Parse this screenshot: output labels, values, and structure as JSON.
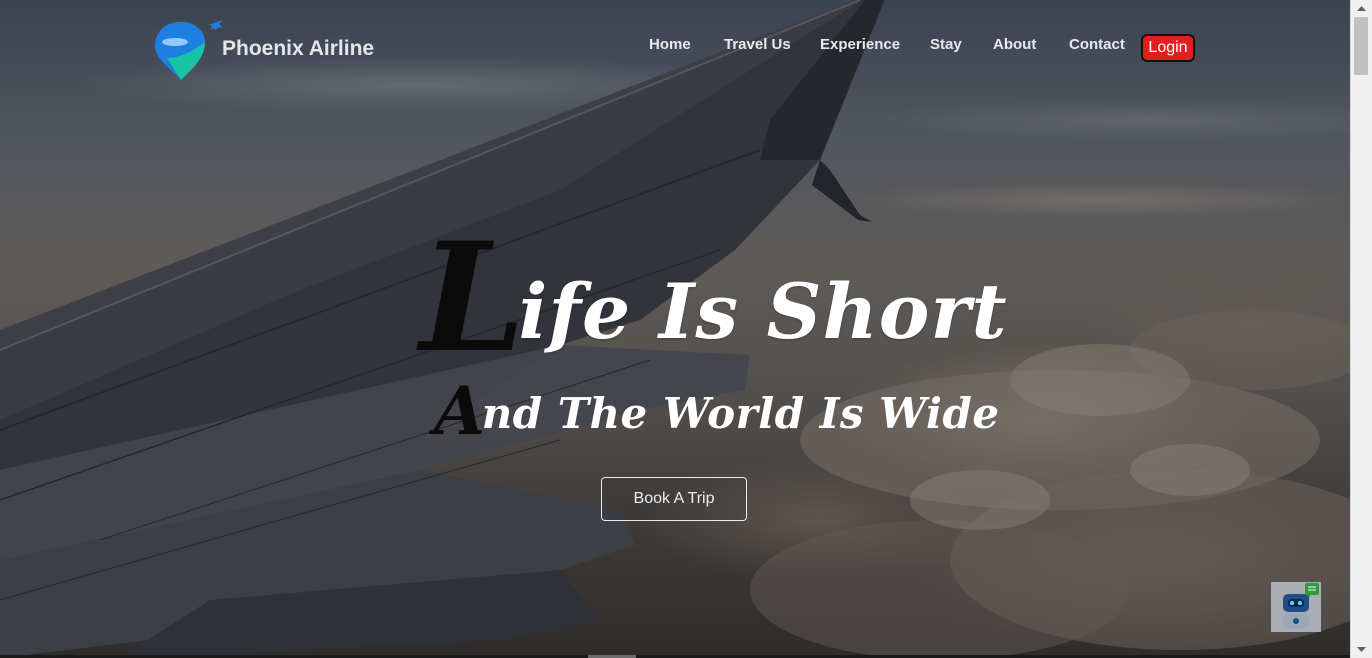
{
  "brand": {
    "name": "Phoenix Airline"
  },
  "nav": {
    "items": [
      {
        "label": "Home"
      },
      {
        "label": "Travel Us"
      },
      {
        "label": "Experience"
      },
      {
        "label": "Stay"
      },
      {
        "label": "About"
      },
      {
        "label": "Contact"
      }
    ],
    "login_label": "Login"
  },
  "hero": {
    "headline_cap": "L",
    "headline_rest": "ife Is Short",
    "subline_cap": "A",
    "subline_rest": "nd The World Is Wide",
    "cta_label": "Book A Trip"
  },
  "icons": {
    "logo": "plane-location-pin-icon",
    "chatbot": "robot-chat-icon"
  },
  "colors": {
    "login_bg": "#e0201f",
    "logo_blue": "#1f7fe0",
    "logo_teal": "#19c4a6"
  }
}
